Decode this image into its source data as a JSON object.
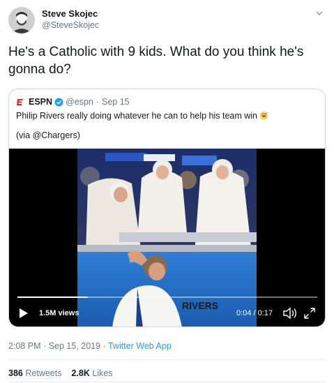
{
  "author": {
    "name": "Steve Skojec",
    "handle": "@SteveSkojec",
    "avatar_icon": "person-avatar"
  },
  "tweet_text": "He's a Catholic with 9 kids. What do you think he's gonna do?",
  "quoted": {
    "name": "ESPN",
    "handle": "@espn",
    "separator": "·",
    "date": "Sep 15",
    "text": "Philip Rivers really doing whatever he can to help his team win",
    "via": "(via @Chargers)",
    "logo_icon": "espn-logo",
    "verified_icon": "verified-badge-icon",
    "emoji_icon": "grinning-sweat-emoji"
  },
  "video": {
    "views": "1.5M views",
    "time": "0:04 / 0:17",
    "progress": 0.235,
    "play_icon": "play-icon",
    "volume_icon": "volume-icon",
    "fullscreen_icon": "fullscreen-icon"
  },
  "meta": {
    "time": "2:08 PM",
    "separator": "·",
    "date": "Sep 15, 2019",
    "app": "Twitter Web App"
  },
  "stats": {
    "retweets_count": "386",
    "retweets_label": "Retweets",
    "likes_count": "2.8K",
    "likes_label": "Likes"
  },
  "colors": {
    "link": "#1da1f2",
    "secondary_text": "#657786",
    "border": "#ccd6dd"
  }
}
